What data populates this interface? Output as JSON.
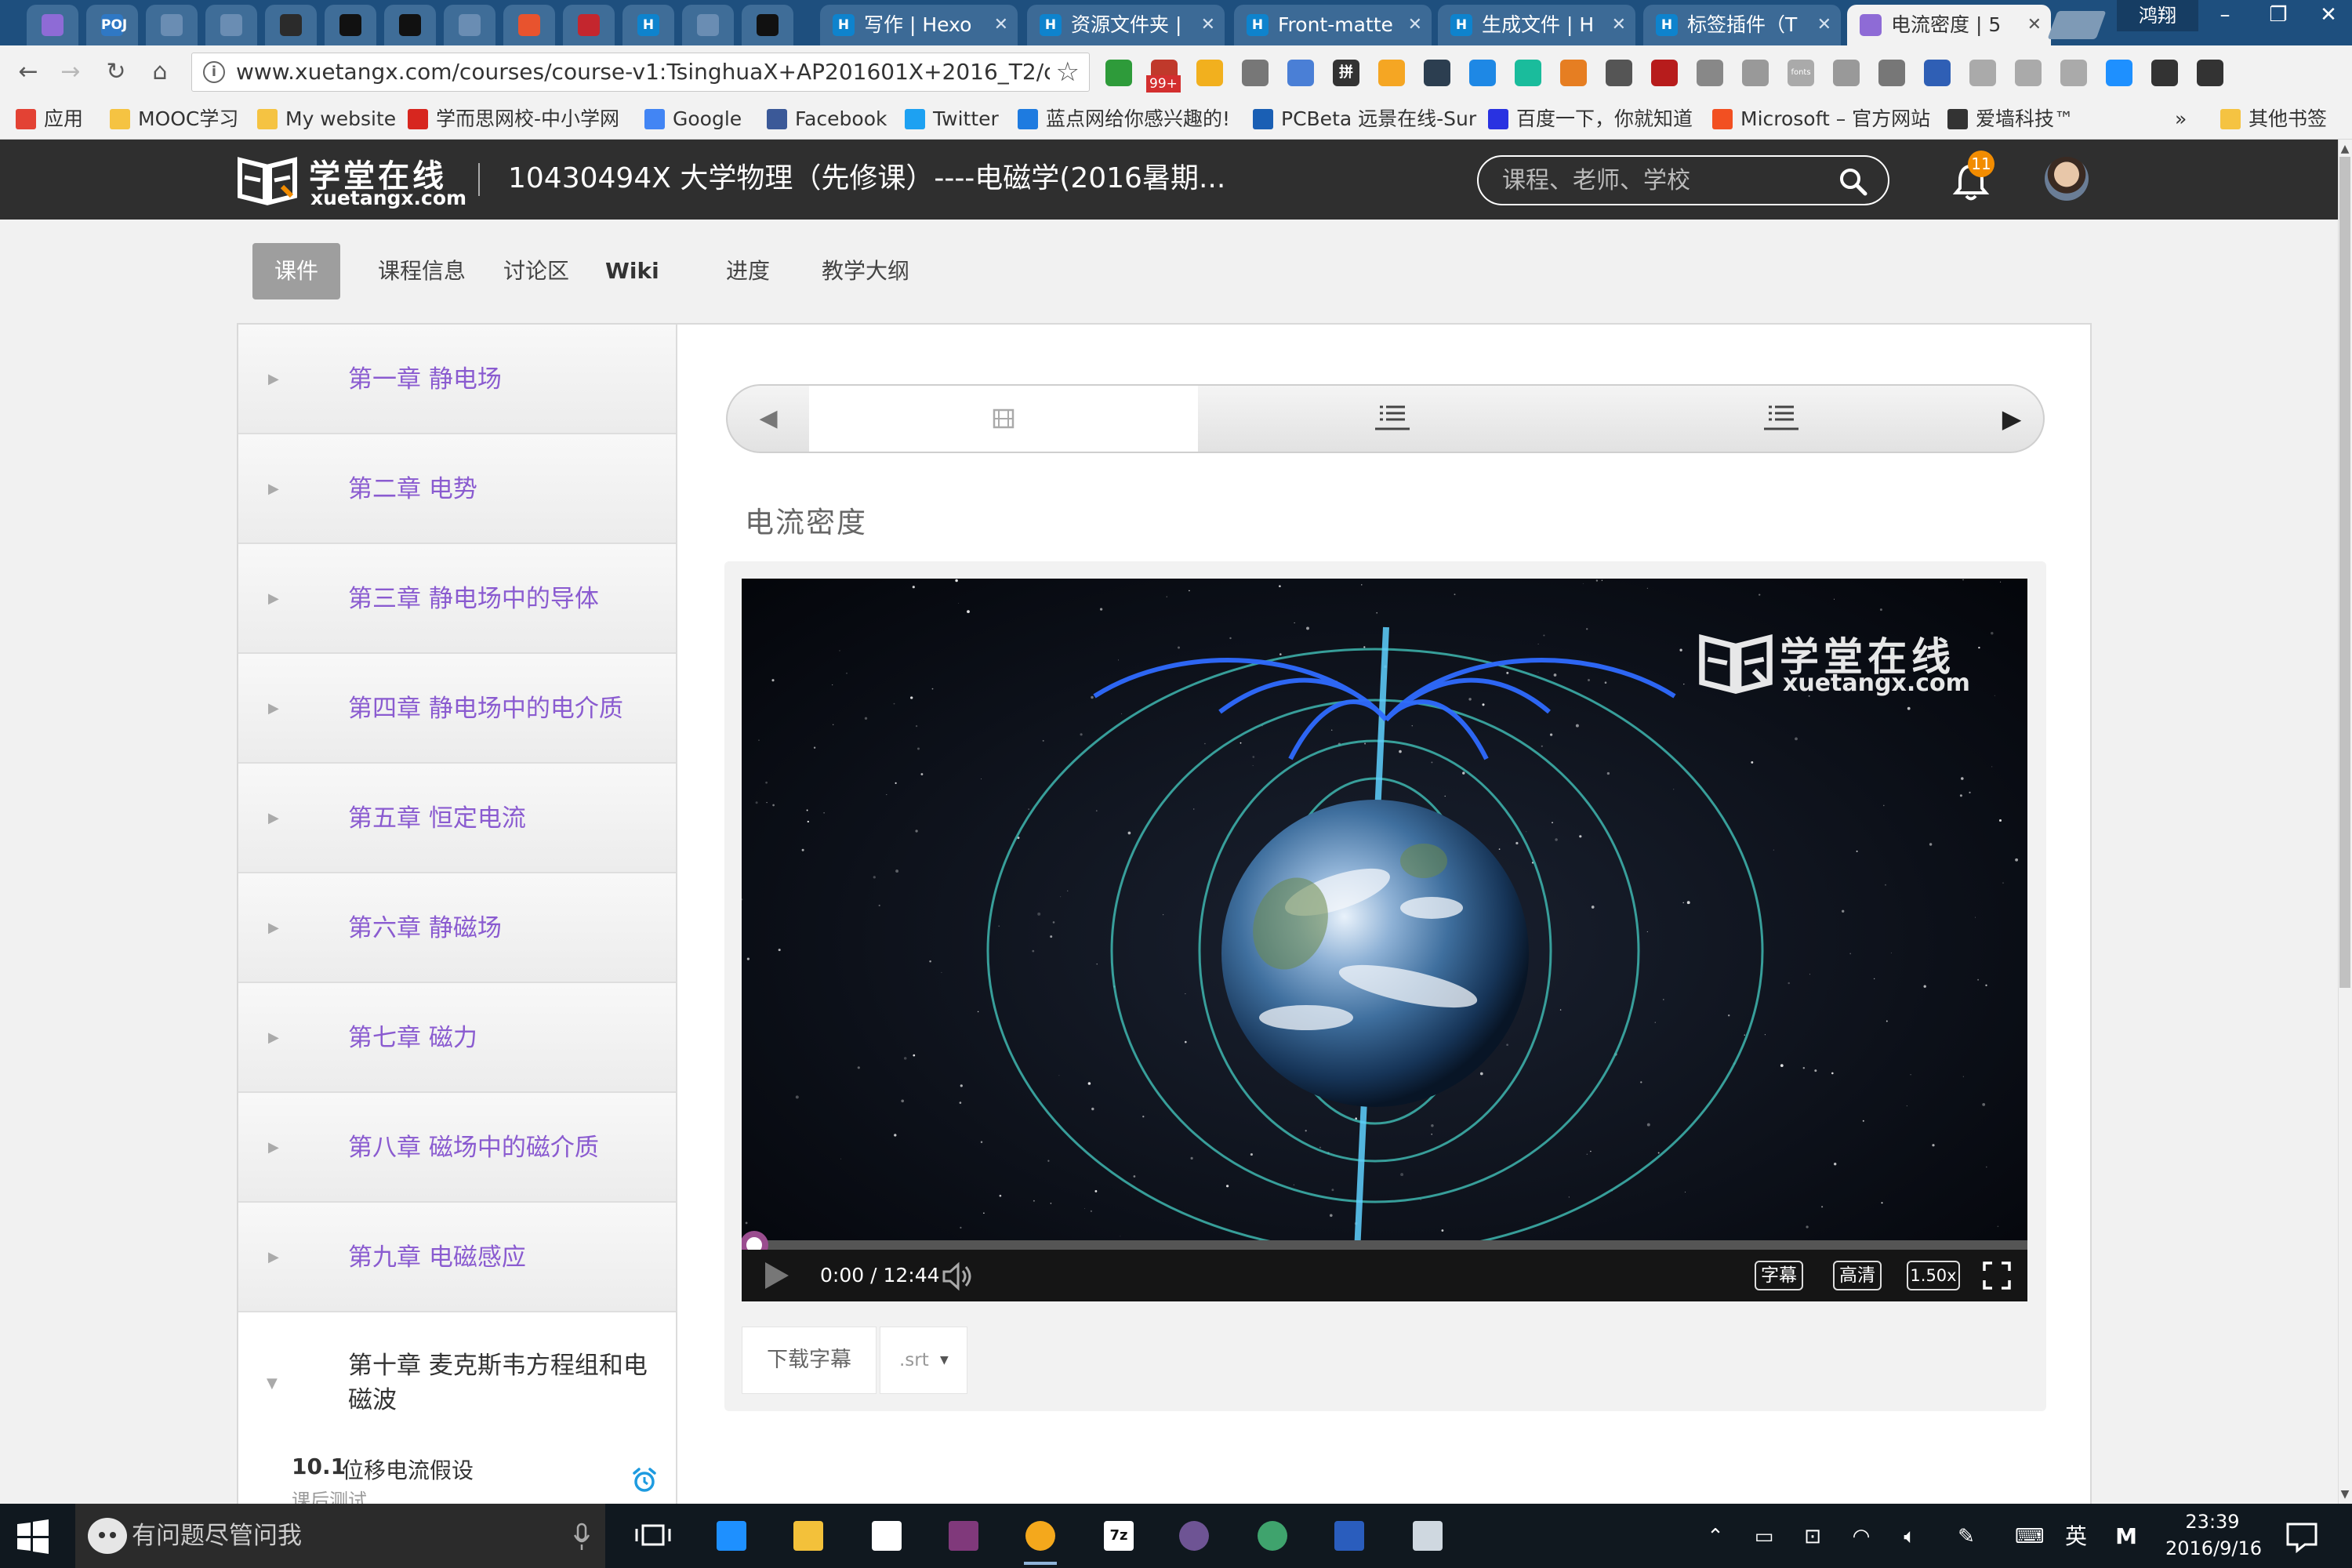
{
  "browser": {
    "tabs": [
      {
        "title": "",
        "icon": "purple-book-icon",
        "color": "#8e6bd6"
      },
      {
        "title": "",
        "icon": "poj-icon",
        "color": "#2f78c4",
        "text": "POJ"
      },
      {
        "title": "",
        "icon": "blank-page-icon",
        "color": "#6a8db3"
      },
      {
        "title": "",
        "icon": "blank-page-icon",
        "color": "#6a8db3"
      },
      {
        "title": "",
        "icon": "reader-icon",
        "color": "#2b2b2b"
      },
      {
        "title": "",
        "icon": "github-icon",
        "color": "#111111"
      },
      {
        "title": "",
        "icon": "github-icon",
        "color": "#111111"
      },
      {
        "title": "",
        "icon": "blank-page-icon",
        "color": "#6a8db3"
      },
      {
        "title": "",
        "icon": "git-diamond-icon",
        "color": "#e8532e"
      },
      {
        "title": "",
        "icon": "red-square-icon",
        "color": "#c4262e"
      },
      {
        "title": "",
        "icon": "hexo-h-icon",
        "color": "#0e83cd",
        "text": "H"
      },
      {
        "title": "",
        "icon": "blank-page-icon",
        "color": "#6a8db3"
      },
      {
        "title": "",
        "icon": "github-icon",
        "color": "#111111"
      },
      {
        "title": "写作 | Hexo",
        "icon": "hexo-h-icon",
        "color": "#0e83cd",
        "text": "H"
      },
      {
        "title": "资源文件夹 |",
        "icon": "hexo-h-icon",
        "color": "#0e83cd",
        "text": "H"
      },
      {
        "title": "Front-matte",
        "icon": "hexo-h-icon",
        "color": "#0e83cd",
        "text": "H"
      },
      {
        "title": "生成文件 | H",
        "icon": "hexo-h-icon",
        "color": "#0e83cd",
        "text": "H"
      },
      {
        "title": "标签插件（T",
        "icon": "hexo-h-icon",
        "color": "#0e83cd",
        "text": "H"
      },
      {
        "title": "电流密度 | 5",
        "icon": "purple-book-icon",
        "color": "#8e6bd6",
        "active": true
      }
    ],
    "profile_name": "鸿翔",
    "url": "www.xuetangx.com/courses/course-v1:TsinghuaX+AP201601X+2016_T2/cou",
    "extension_badge": "99+",
    "extension_text_1": "拼",
    "extension_text_2": "fonts",
    "bookmarks": [
      {
        "label": "应用",
        "icon": "apps-grid-icon",
        "color": "#e34234"
      },
      {
        "label": "MOOC学习",
        "icon": "folder-icon",
        "color": "#f5c342"
      },
      {
        "label": "My website",
        "icon": "folder-icon",
        "color": "#f5c342"
      },
      {
        "label": "学而思网校-中小学网",
        "icon": "xueersi-icon",
        "color": "#d7261f"
      },
      {
        "label": "Google",
        "icon": "google-icon",
        "color": "#4285f4"
      },
      {
        "label": "Facebook",
        "icon": "facebook-icon",
        "color": "#3b5998"
      },
      {
        "label": "Twitter",
        "icon": "twitter-icon",
        "color": "#1da1f2"
      },
      {
        "label": "蓝点网给你感兴趣的!",
        "icon": "landian-icon",
        "color": "#1e7be0"
      },
      {
        "label": "PCBeta 远景在线-Sur",
        "icon": "pcbeta-icon",
        "color": "#1a5fb4"
      },
      {
        "label": "百度一下，你就知道",
        "icon": "baidu-paw-icon",
        "color": "#2932e1"
      },
      {
        "label": "Microsoft – 官方网站",
        "icon": "microsoft-icon",
        "color": "#f25022"
      },
      {
        "label": "爱墙科技™",
        "icon": "aiqiang-icon",
        "color": "#333333"
      },
      {
        "label": "其他书签",
        "icon": "folder-icon",
        "color": "#f5c342"
      }
    ],
    "more_bookmarks": "»"
  },
  "site": {
    "logo_zh": "学堂在线",
    "logo_en": "xuetangx.com",
    "course_title": "10430494X 大学物理（先修课）----电磁学(2016暑期...",
    "search_placeholder": "课程、老师、学校",
    "notification_count": "11",
    "nav_tabs": [
      {
        "label": "课件",
        "active": true
      },
      {
        "label": "课程信息"
      },
      {
        "label": "讨论区"
      },
      {
        "label": "Wiki"
      },
      {
        "label": "进度"
      },
      {
        "label": "教学大纲"
      }
    ]
  },
  "sidebar": {
    "chapters": [
      {
        "label": "第一章 静电场"
      },
      {
        "label": "第二章 电势"
      },
      {
        "label": "第三章 静电场中的导体"
      },
      {
        "label": "第四章 静电场中的电介质"
      },
      {
        "label": "第五章 恒定电流"
      },
      {
        "label": "第六章 静磁场"
      },
      {
        "label": "第七章  磁力"
      },
      {
        "label": "第八章 磁场中的磁介质"
      },
      {
        "label": "第九章 电磁感应"
      }
    ],
    "expanded_chapter": "第十章 麦克斯韦方程组和电磁波",
    "section_number": "10.1",
    "section_title": "位移电流假设",
    "section_subtitle": "课后测试"
  },
  "content": {
    "unit_title": "电流密度",
    "sequence": {
      "prev": "◀",
      "next": "▶",
      "tabs": [
        {
          "icon": "video-film-icon",
          "active": true
        },
        {
          "icon": "problem-list-icon"
        },
        {
          "icon": "problem-list-icon"
        }
      ]
    },
    "video": {
      "watermark_zh": "学堂在线",
      "watermark_en": "xuetangx.com",
      "current_time": "0:00",
      "duration": "12:44",
      "time_separator": " / ",
      "progress_fraction": 0.0,
      "buffered_fraction": 0.0,
      "subtitle_button": "字幕",
      "quality_button": "高清",
      "speed_button": "1.50x"
    },
    "download_subtitle": "下载字幕",
    "subtitle_format": ".srt"
  },
  "taskbar": {
    "search_placeholder": "有问题尽管问我",
    "apps": [
      {
        "icon": "edge-icon",
        "color": "#1e90ff"
      },
      {
        "icon": "file-explorer-icon",
        "color": "#f3c13a"
      },
      {
        "icon": "store-icon",
        "color": "#ffffff"
      },
      {
        "icon": "onenote-icon",
        "color": "#80397b"
      },
      {
        "icon": "chrome-canary-icon",
        "color": "#f4a81c",
        "running": true
      },
      {
        "icon": "7zip-icon",
        "color": "#ffffff",
        "text": "7z"
      },
      {
        "icon": "github-desktop-icon",
        "color": "#6e5494"
      },
      {
        "icon": "git-extensions-icon",
        "color": "#3fa36d"
      },
      {
        "icon": "powershell-icon",
        "color": "#2a5dbd"
      },
      {
        "icon": "remote-desktop-icon",
        "color": "#cfd8e0"
      }
    ],
    "ime": "英",
    "ime_mode": "M",
    "time": "23:39",
    "date": "2016/9/16"
  }
}
